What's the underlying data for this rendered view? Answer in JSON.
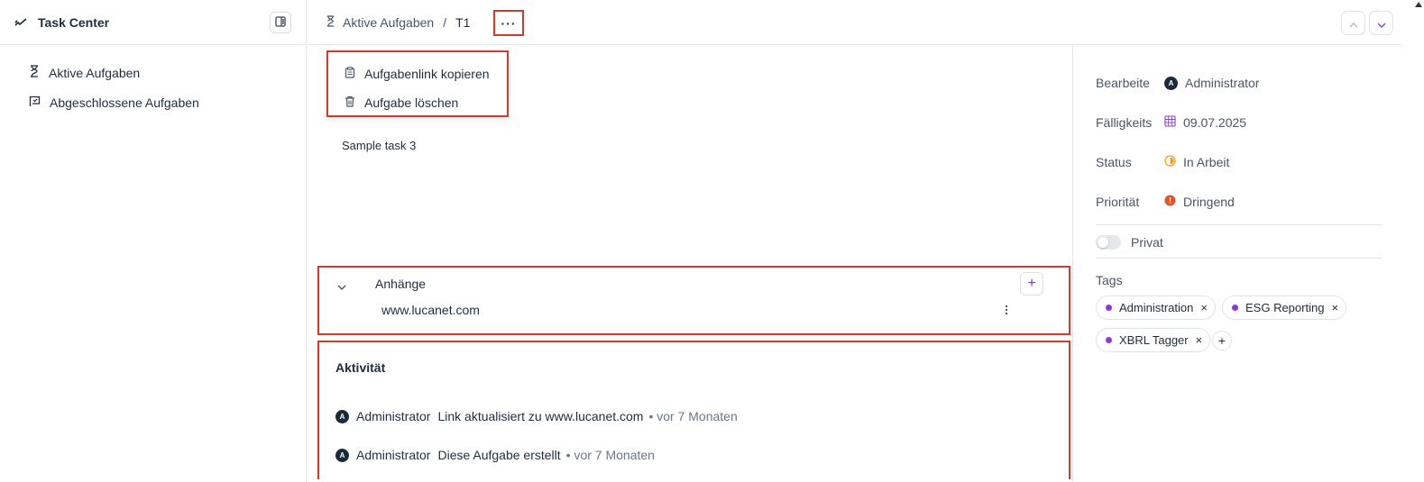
{
  "sidebar": {
    "title": "Task Center",
    "items": [
      {
        "label": "Aktive Aufgaben"
      },
      {
        "label": "Abgeschlossene Aufgaben"
      }
    ]
  },
  "header": {
    "breadcrumb_parent": "Aktive Aufgaben",
    "breadcrumb_sep": "/",
    "breadcrumb_current": "T1",
    "more_label": "···"
  },
  "menu": {
    "copy_link": "Aufgabenlink kopieren",
    "delete": "Aufgabe löschen"
  },
  "task": {
    "description": "Sample task 3"
  },
  "attachments": {
    "heading": "Anhänge",
    "add_label": "+",
    "items": [
      {
        "label": "www.lucanet.com"
      }
    ]
  },
  "activity": {
    "heading": "Aktivität",
    "entries": [
      {
        "avatar": "A",
        "user": "Administrator",
        "message": "Link aktualisiert zu www.lucanet.com",
        "time": "• vor 7 Monaten"
      },
      {
        "avatar": "A",
        "user": "Administrator",
        "message": "Diese Aufgabe erstellt",
        "time": "• vor 7 Monaten"
      }
    ]
  },
  "details": {
    "assignee_label": "Bearbeite",
    "assignee_avatar": "A",
    "assignee_value": "Administrator",
    "due_label": "Fälligkeits",
    "due_value": "09.07.2025",
    "status_label": "Status",
    "status_value": "In Arbeit",
    "priority_label": "Priorität",
    "priority_value": "Dringend",
    "private_label": "Privat",
    "tags_label": "Tags",
    "tags": [
      {
        "label": "Administration"
      },
      {
        "label": "ESG Reporting"
      },
      {
        "label": "XBRL Tagger"
      }
    ],
    "tag_remove": "×",
    "tag_add": "+"
  },
  "colors": {
    "accent": "#8a3ccf",
    "highlight": "#d23a2a",
    "status": "#f0a030",
    "priority": "#e0552e"
  }
}
